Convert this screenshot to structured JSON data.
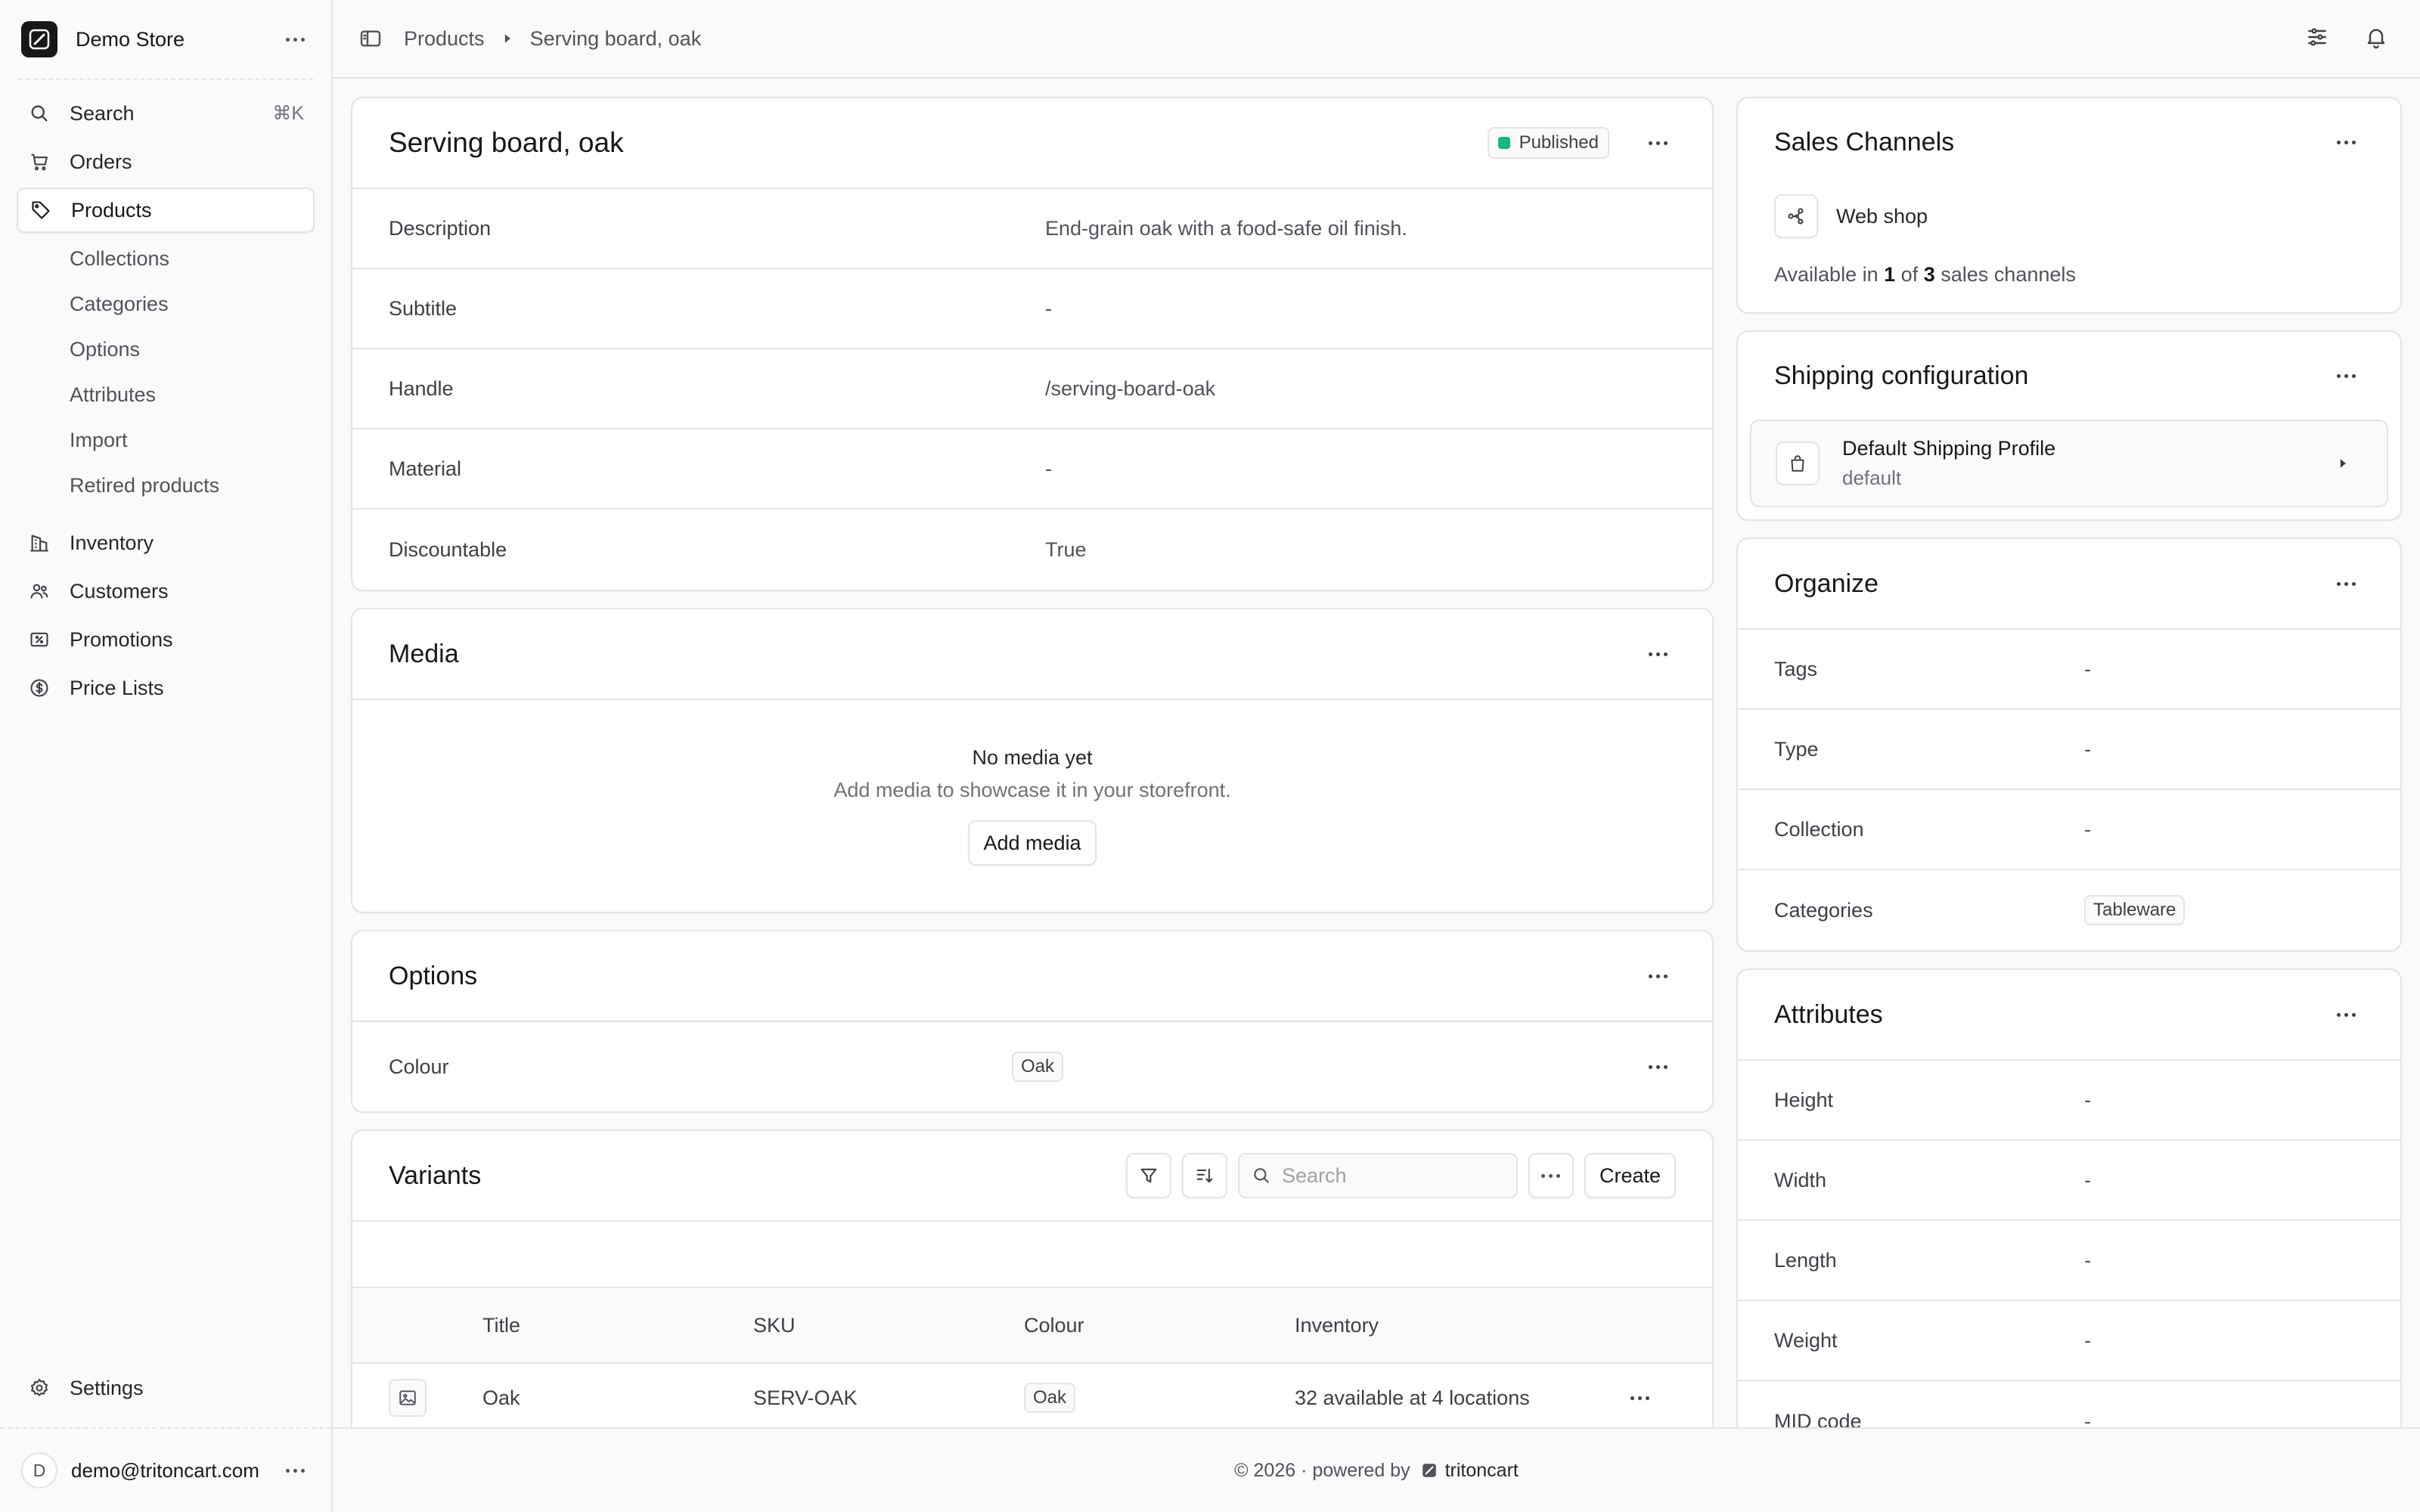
{
  "sidebar": {
    "store_name": "Demo Store",
    "nav": [
      {
        "label": "Search",
        "shortcut": "⌘K",
        "icon": "search-icon"
      },
      {
        "label": "Orders",
        "icon": "cart-icon"
      },
      {
        "label": "Products",
        "icon": "tag-icon",
        "active": true
      }
    ],
    "product_sub": [
      "Collections",
      "Categories",
      "Options",
      "Attributes",
      "Import",
      "Retired products"
    ],
    "nav2": [
      {
        "label": "Inventory",
        "icon": "building-icon"
      },
      {
        "label": "Customers",
        "icon": "users-icon"
      },
      {
        "label": "Promotions",
        "icon": "receipt-percent-icon"
      },
      {
        "label": "Price Lists",
        "icon": "currency-dollar-icon"
      }
    ],
    "settings_label": "Settings",
    "user": {
      "initial": "D",
      "email": "demo@tritoncart.com"
    }
  },
  "breadcrumb": {
    "root": "Products",
    "current": "Serving board, oak"
  },
  "product": {
    "title": "Serving board, oak",
    "status": "Published",
    "status_color": "#10b981",
    "fields": [
      {
        "label": "Description",
        "value": "End-grain oak with a food-safe oil finish."
      },
      {
        "label": "Subtitle",
        "value": "-"
      },
      {
        "label": "Handle",
        "value": "/serving-board-oak"
      },
      {
        "label": "Material",
        "value": "-"
      },
      {
        "label": "Discountable",
        "value": "True"
      }
    ]
  },
  "media": {
    "title": "Media",
    "empty_title": "No media yet",
    "empty_sub": "Add media to showcase it in your storefront.",
    "add_button": "Add media"
  },
  "options": {
    "title": "Options",
    "items": [
      {
        "label": "Colour",
        "value": "Oak"
      }
    ]
  },
  "variants": {
    "title": "Variants",
    "search_placeholder": "Search",
    "create_button": "Create",
    "columns": [
      "Title",
      "SKU",
      "Colour",
      "Inventory"
    ],
    "rows": [
      {
        "title": "Oak",
        "sku": "SERV-OAK",
        "colour": "Oak",
        "inventory": "32 available at 4 locations"
      }
    ]
  },
  "sales_channels": {
    "title": "Sales Channels",
    "channel": "Web shop",
    "avail_prefix": "Available in",
    "avail_count": "1",
    "avail_of": "of",
    "avail_total": "3",
    "avail_suffix": "sales channels"
  },
  "shipping": {
    "title": "Shipping configuration",
    "profile_name": "Default Shipping Profile",
    "profile_sub": "default"
  },
  "organize": {
    "title": "Organize",
    "fields": [
      {
        "label": "Tags",
        "value": "-"
      },
      {
        "label": "Type",
        "value": "-"
      },
      {
        "label": "Collection",
        "value": "-"
      }
    ],
    "categories_label": "Categories",
    "categories_value": "Tableware"
  },
  "attributes": {
    "title": "Attributes",
    "fields": [
      {
        "label": "Height",
        "value": "-"
      },
      {
        "label": "Width",
        "value": "-"
      },
      {
        "label": "Length",
        "value": "-"
      },
      {
        "label": "Weight",
        "value": "-"
      },
      {
        "label": "MID code",
        "value": "-"
      }
    ]
  },
  "footer": {
    "text": "© 2026 · powered by",
    "brand": "tritoncart"
  }
}
